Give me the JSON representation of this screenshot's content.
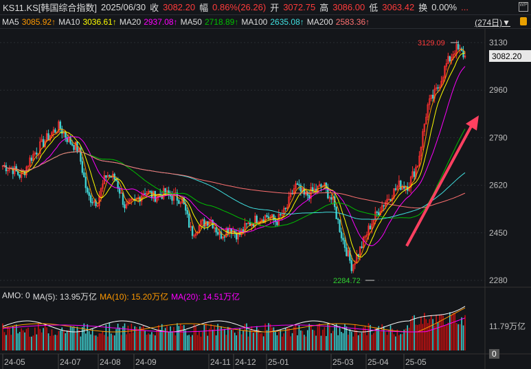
{
  "header": {
    "symbol": "KS11.KS[韩国综合指数]",
    "date": "2025/06/30",
    "close_label": "收",
    "close": "3082.20",
    "change_label": "幅",
    "change": "0.86%(26.26)",
    "open_label": "开",
    "open": "3072.75",
    "high_label": "高",
    "high": "3086.00",
    "low_label": "低",
    "low": "3063.42",
    "turnover_label": "换",
    "turnover": "0.00%",
    "more": "...",
    "wp": "WP"
  },
  "ma": [
    {
      "label": "MA5",
      "value": "3085.92↑",
      "color": "#ff9900"
    },
    {
      "label": "MA10",
      "value": "3036.61↑",
      "color": "#ffff00"
    },
    {
      "label": "MA20",
      "value": "2937.08↑",
      "color": "#ff00ff"
    },
    {
      "label": "MA50",
      "value": "2718.89↑",
      "color": "#00c000"
    },
    {
      "label": "MA100",
      "value": "2635.08↑",
      "color": "#40e0e0"
    },
    {
      "label": "MA200",
      "value": "2583.36↑",
      "color": "#ff7070"
    }
  ],
  "period": "(274日)▼",
  "price_axis": [
    "3130",
    "2960",
    "2790",
    "2620",
    "2450",
    "2280"
  ],
  "last_price": "3082.20",
  "max_label": "3129.09",
  "min_label": "2284.72",
  "amo": {
    "label": "AMO: 0",
    "ma5": "MA(5): 13.95万亿",
    "ma10": "MA(10): 15.20万亿",
    "ma20": "MA(20): 14.51万亿",
    "axis": "11.79万亿",
    "zero": "0"
  },
  "months": [
    "24-05",
    "24-07",
    "24-08",
    "24-09",
    "24-11",
    "24-12",
    "25-01",
    "25-03",
    "25-04",
    "25-05"
  ],
  "chart_data": {
    "type": "candlestick",
    "ylim": [
      2280,
      3130
    ],
    "closes": [
      2690,
      2680,
      2650,
      2720,
      2760,
      2800,
      2830,
      2780,
      2750,
      2580,
      2560,
      2660,
      2640,
      2540,
      2560,
      2600,
      2580,
      2590,
      2580,
      2570,
      2450,
      2480,
      2500,
      2440,
      2470,
      2440,
      2480,
      2500,
      2510,
      2490,
      2530,
      2620,
      2580,
      2600,
      2620,
      2560,
      2430,
      2330,
      2400,
      2480,
      2540,
      2580,
      2620,
      2620,
      2700,
      2900,
      2960,
      3050,
      3110,
      3082
    ]
  }
}
